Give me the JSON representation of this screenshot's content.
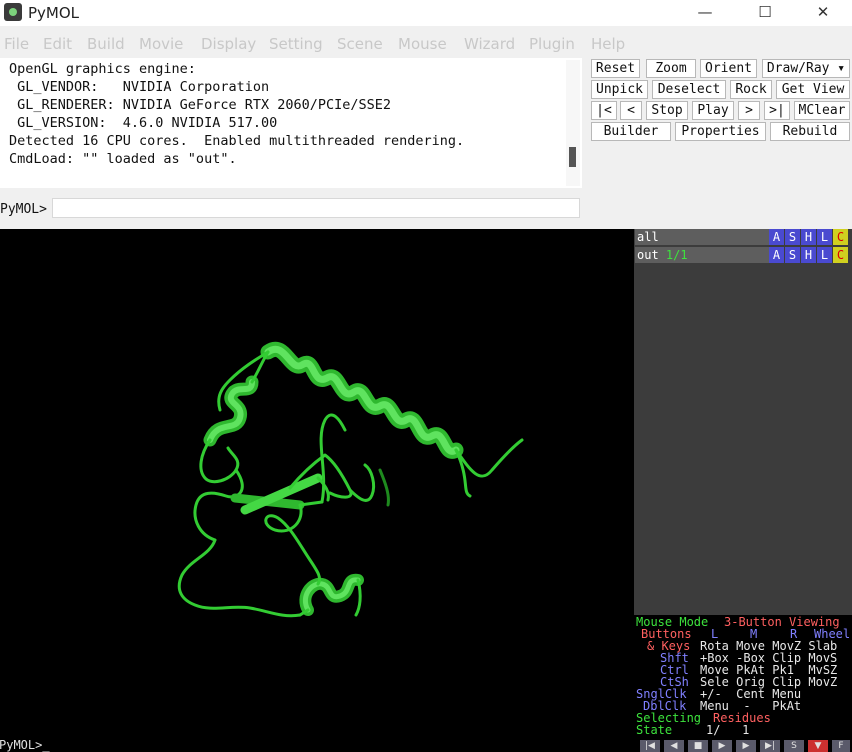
{
  "window": {
    "title": "PyMOL",
    "minimize_glyph": "—",
    "maximize_glyph": "☐",
    "close_glyph": "✕"
  },
  "menu": [
    "File",
    "Edit",
    "Build",
    "Movie",
    "Display",
    "Setting",
    "Scene",
    "Mouse",
    "Wizard",
    "Plugin",
    "Help"
  ],
  "console": {
    "lines": [
      "OpenGL graphics engine:",
      " GL_VENDOR:   NVIDIA Corporation",
      " GL_RENDERER: NVIDIA GeForce RTX 2060/PCIe/SSE2",
      " GL_VERSION:  4.6.0 NVIDIA 517.00",
      "Detected 16 CPU cores.  Enabled multithreaded rendering.",
      "CmdLoad: \"\" loaded as \"out\"."
    ],
    "prompt": "PyMOL>",
    "input_value": ""
  },
  "buttons": {
    "reset": "Reset",
    "zoom": "Zoom",
    "orient": "Orient",
    "draw_ray": "Draw/Ray ▾",
    "unpick": "Unpick",
    "deselect": "Deselect",
    "rock": "Rock",
    "get_view": "Get View",
    "first": "|<",
    "prev": "<",
    "stop": "Stop",
    "play": "Play",
    "next": ">",
    "last": ">|",
    "mclear": "MClear",
    "builder": "Builder",
    "properties": "Properties",
    "rebuild": "Rebuild"
  },
  "objects": [
    {
      "name": "all",
      "state": ""
    },
    {
      "name": "out",
      "state": "1/1"
    }
  ],
  "object_buttons": [
    "A",
    "S",
    "H",
    "L",
    "C"
  ],
  "mouse_panel": {
    "mode_label": "Mouse Mode",
    "mode_value": "3-Button Viewing",
    "buttons_label": "Buttons",
    "col_l": "L",
    "col_m": "M",
    "col_r": "R",
    "col_wheel": "Wheel",
    "rows": [
      {
        "key": "& Keys",
        "values": "Rota Move MovZ Slab"
      },
      {
        "key": "Shft",
        "values": "+Box -Box Clip MovS"
      },
      {
        "key": "Ctrl",
        "values": "Move PkAt Pk1  MvSZ"
      },
      {
        "key": "CtSh",
        "values": "Sele Orig Clip MovZ"
      },
      {
        "key": "SnglClk",
        "values": "+/-  Cent Menu"
      },
      {
        "key": "DblClk",
        "values": "Menu  -   PkAt"
      }
    ],
    "selecting_label": "Selecting",
    "selecting_value": "Residues",
    "state_label": "State",
    "state_value": "1/   1"
  },
  "playback_glyphs": [
    "|◀",
    "◀",
    "■",
    "▶",
    "▶",
    "▶|",
    "S",
    "▼",
    "F"
  ],
  "viewer": {
    "prompt": "PyMOL>_",
    "background": "#000000",
    "cartoon_color": "#33cc33"
  }
}
